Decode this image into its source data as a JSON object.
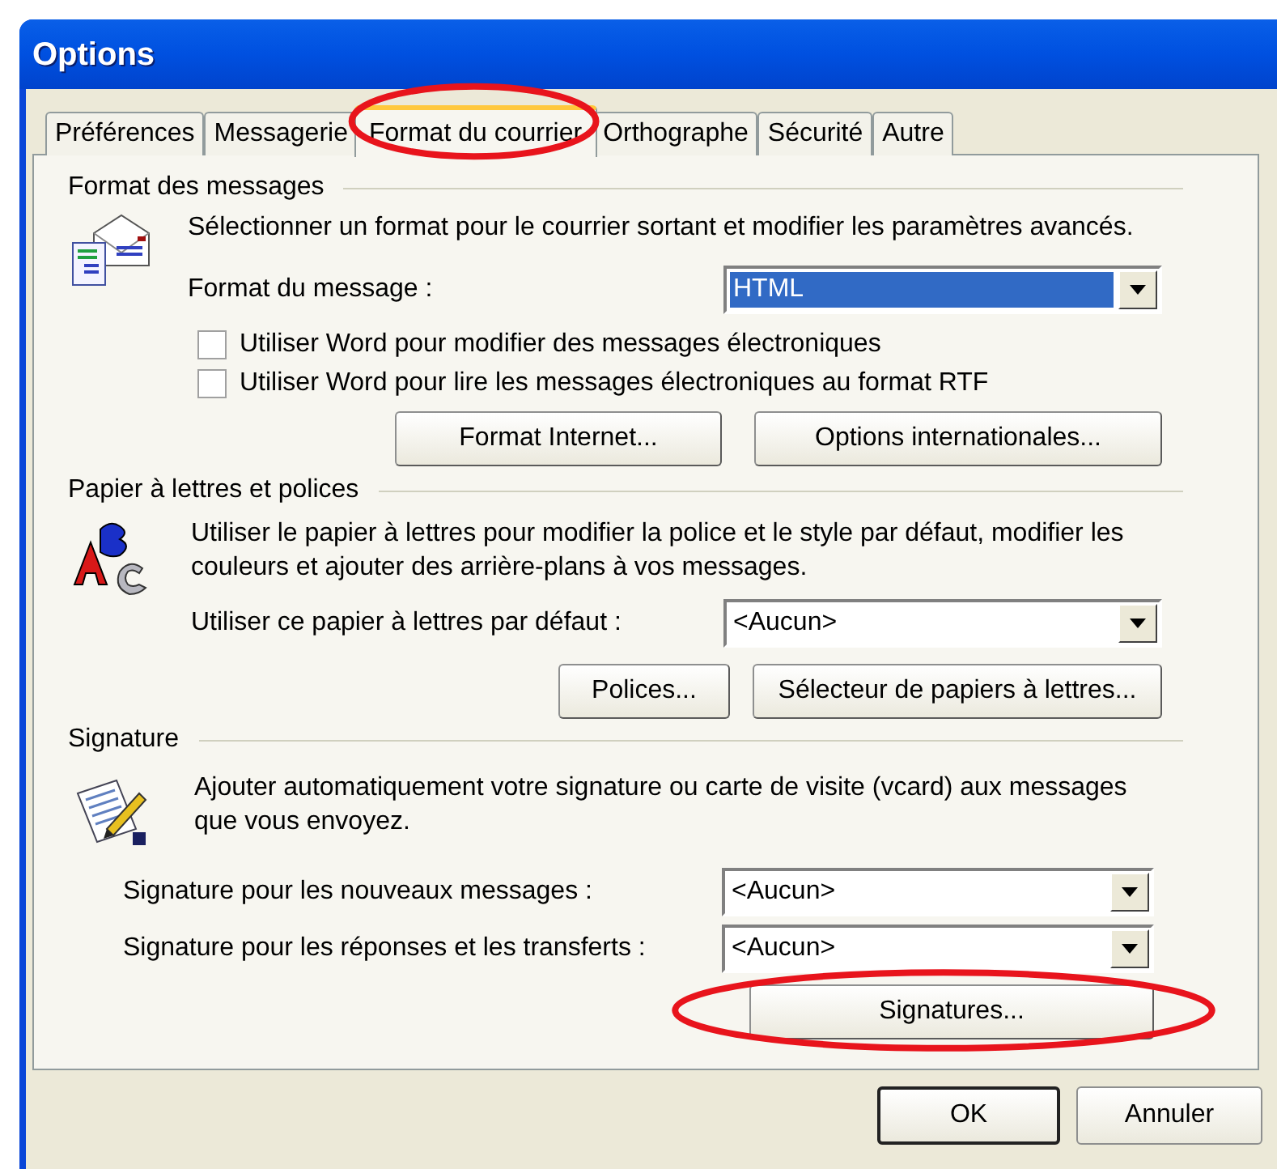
{
  "window": {
    "title": "Options"
  },
  "tabs": [
    {
      "label": "Préférences",
      "selected": false,
      "circled": false
    },
    {
      "label": "Messagerie",
      "selected": false,
      "circled": false
    },
    {
      "label": "Format du courrier",
      "selected": true,
      "circled": true
    },
    {
      "label": "Orthographe",
      "selected": false,
      "circled": false
    },
    {
      "label": "Sécurité",
      "selected": false,
      "circled": false
    },
    {
      "label": "Autre",
      "selected": false,
      "circled": false
    }
  ],
  "sections": [
    {
      "title": "Format des messages",
      "description": "Sélectionner un format pour le courrier sortant et modifier les paramètres avancés.",
      "rows": [
        {
          "kind": "dropdown",
          "label": "Format du message :",
          "value": "HTML",
          "highlighted": true
        },
        {
          "kind": "checkbox",
          "label": "Utiliser Word pour modifier des messages électroniques",
          "checked": false
        },
        {
          "kind": "checkbox",
          "label": "Utiliser Word pour lire les messages électroniques au format RTF",
          "checked": false
        },
        {
          "kind": "buttons",
          "buttons": [
            {
              "label": "Format Internet...",
              "circled": false
            },
            {
              "label": "Options internationales...",
              "circled": false
            }
          ]
        }
      ]
    },
    {
      "title": "Papier à lettres et polices",
      "description": "Utiliser le papier à lettres pour modifier la police et le style par défaut, modifier les couleurs et ajouter des arrière-plans à vos messages.",
      "rows": [
        {
          "kind": "dropdown",
          "label": "Utiliser ce papier à lettres par défaut :",
          "value": "<Aucun>",
          "highlighted": false
        },
        {
          "kind": "buttons",
          "buttons": [
            {
              "label": "Polices...",
              "circled": false
            },
            {
              "label": "Sélecteur de papiers à lettres...",
              "circled": false
            }
          ]
        }
      ]
    },
    {
      "title": "Signature",
      "description": "Ajouter automatiquement votre signature ou carte de visite (vcard) aux messages que vous envoyez.",
      "rows": [
        {
          "kind": "dropdown",
          "label": "Signature pour les nouveaux messages :",
          "value": "<Aucun>",
          "highlighted": false
        },
        {
          "kind": "dropdown",
          "label": "Signature pour les réponses et les transferts :",
          "value": "<Aucun>",
          "highlighted": false
        },
        {
          "kind": "buttons",
          "buttons": [
            {
              "label": "Signatures...",
              "circled": true
            }
          ]
        }
      ]
    }
  ],
  "footer_buttons": [
    {
      "label": "OK",
      "default": true
    },
    {
      "label": "Annuler",
      "default": false
    }
  ]
}
